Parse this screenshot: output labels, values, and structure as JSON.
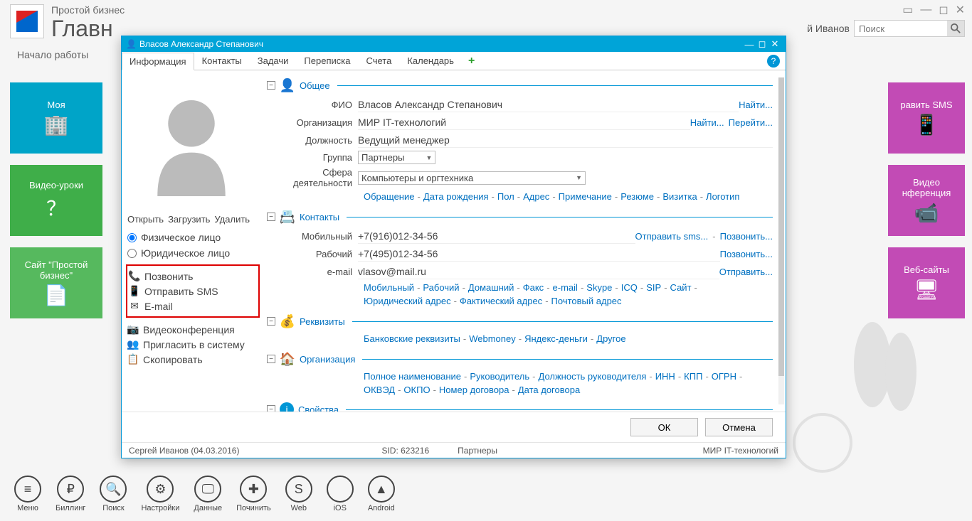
{
  "app": {
    "subtitle": "Простой бизнес",
    "title": "Главн",
    "section": "Начало работы",
    "user": "й Иванов",
    "search_placeholder": "Поиск"
  },
  "tiles_left": [
    {
      "label": "Моя",
      "color": "cyan"
    },
    {
      "label": "Видео-уроки",
      "color": "green"
    },
    {
      "label": "Сайт \"Простой бизнес\"",
      "color": "green2"
    }
  ],
  "tiles_right": [
    {
      "label": "равить SMS",
      "color": "mag"
    },
    {
      "label": "Видео нференция",
      "color": "mag"
    },
    {
      "label": "Веб-сайты",
      "color": "mag"
    }
  ],
  "bottom": [
    {
      "label": "Меню"
    },
    {
      "label": "Биллинг"
    },
    {
      "label": "Поиск"
    },
    {
      "label": "Настройки"
    },
    {
      "label": "Данные"
    },
    {
      "label": "Починить"
    },
    {
      "label": "Web"
    },
    {
      "label": "iOS"
    },
    {
      "label": "Android"
    }
  ],
  "dialog": {
    "title": "Власов Александр Степанович",
    "tabs": [
      "Информация",
      "Контакты",
      "Задачи",
      "Переписка",
      "Счета",
      "Календарь"
    ],
    "active_tab": 0,
    "avatar_actions": {
      "open": "Открыть",
      "upload": "Загрузить",
      "delete": "Удалить"
    },
    "entity_type": {
      "individual": "Физическое лицо",
      "legal": "Юридическое лицо"
    },
    "actions": {
      "call": "Позвонить",
      "sms": "Отправить SMS",
      "email": "E-mail",
      "video": "Видеоконференция",
      "invite": "Пригласить в систему",
      "copy": "Скопировать"
    },
    "sections": {
      "general": {
        "title": "Общее",
        "fields": {
          "fio_label": "ФИО",
          "fio": "Власов Александр Степанович",
          "org_label": "Организация",
          "org": "МИР IT-технологий",
          "pos_label": "Должность",
          "pos": "Ведущий менеджер",
          "group_label": "Группа",
          "group": "Партнеры",
          "sphere_label": "Сфера деятельности",
          "sphere": "Компьютеры и оргтехника"
        },
        "links_find": "Найти...",
        "links_goto": "Перейти...",
        "more_links": [
          "Обращение",
          "Дата рождения",
          "Пол",
          "Адрес",
          "Примечание",
          "Резюме",
          "Визитка",
          "Логотип"
        ]
      },
      "contacts": {
        "title": "Контакты",
        "mobile_label": "Мобильный",
        "mobile": "+7(916)012-34-56",
        "work_label": "Рабочий",
        "work": "+7(495)012-34-56",
        "email_label": "e-mail",
        "email": "vlasov@mail.ru",
        "send_sms": "Отправить sms...",
        "call": "Позвонить...",
        "send": "Отправить...",
        "more_links": [
          "Мобильный",
          "Рабочий",
          "Домашний",
          "Факс",
          "e-mail",
          "Skype",
          "ICQ",
          "SIP",
          "Сайт",
          "Юридический адрес",
          "Фактический адрес",
          "Почтовый адрес"
        ]
      },
      "requisites": {
        "title": "Реквизиты",
        "more_links": [
          "Банковские реквизиты",
          "Webmoney",
          "Яндекс-деньги",
          "Другое"
        ]
      },
      "organization": {
        "title": "Организация",
        "more_links": [
          "Полное наименование",
          "Руководитель",
          "Должность руководителя",
          "ИНН",
          "КПП",
          "ОГРН",
          "ОКВЭД",
          "ОКПО",
          "Номер договора",
          "Дата договора"
        ]
      },
      "properties": {
        "title": "Свойства"
      }
    },
    "buttons": {
      "ok": "ОК",
      "cancel": "Отмена"
    },
    "status": {
      "left": "Сергей Иванов (04.03.2016)",
      "sid": "SID: 623216",
      "group": "Партнеры",
      "org": "МИР IT-технологий"
    }
  }
}
